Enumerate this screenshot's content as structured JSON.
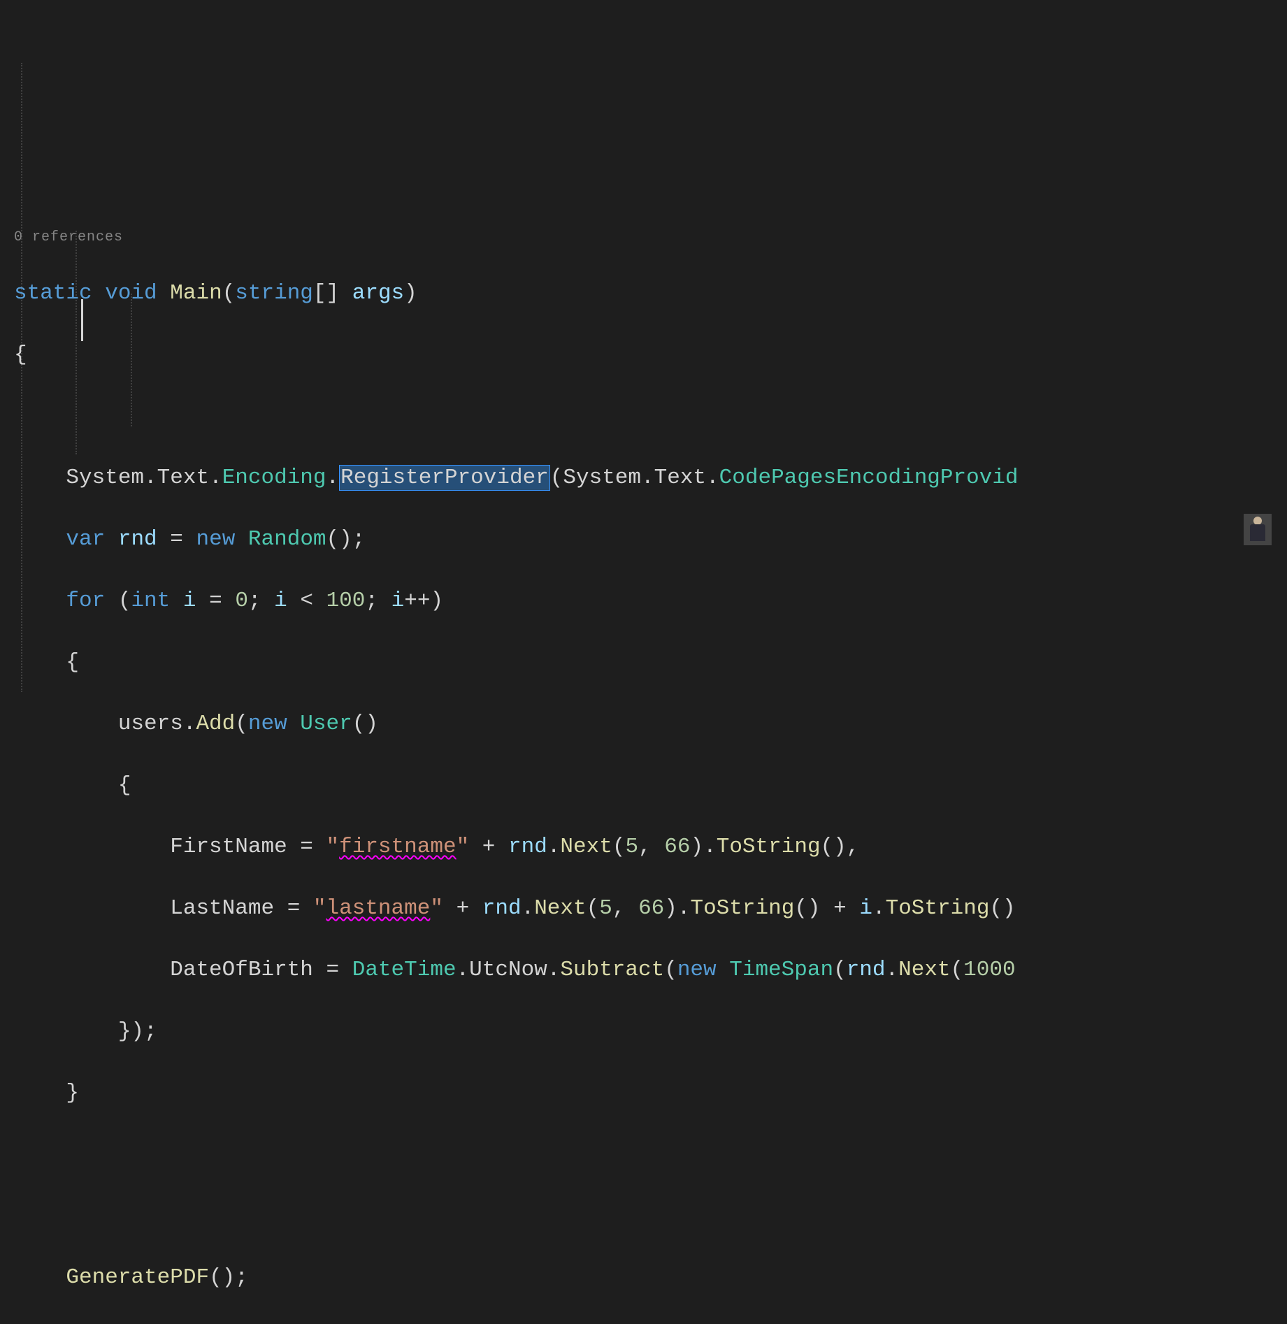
{
  "codelens": "0 references",
  "tokens": {
    "kw_static": "static",
    "kw_void": "void",
    "m_main": "Main",
    "t_string": "string",
    "id_args": "args",
    "ns_system": "System",
    "ns_text": "Text",
    "t_encoding": "Encoding",
    "m_register": "RegisterProvider",
    "t_codepages": "CodePagesEncodingProvid",
    "kw_var": "var",
    "id_rnd": "rnd",
    "kw_new": "new",
    "t_random": "Random",
    "kw_for": "for",
    "kw_int": "int",
    "id_i": "i",
    "n0": "0",
    "n100": "100",
    "id_users": "users",
    "m_add": "Add",
    "t_user": "User",
    "p_firstname": "FirstName",
    "s_firstq1": "\"",
    "s_first": "firstname",
    "s_firstq2": "\"",
    "n5": "5",
    "n66": "66",
    "m_tostring": "ToString",
    "m_next": "Next",
    "p_lastname": "LastName",
    "s_lastq1": "\"",
    "s_last": "lastname",
    "s_lastq2": "\"",
    "p_dob": "DateOfBirth",
    "t_datetime": "DateTime",
    "p_utcnow": "UtcNow",
    "m_subtract": "Subtract",
    "t_timespan": "TimeSpan",
    "n1000": "1000",
    "m_genpdf": "GeneratePDF"
  }
}
